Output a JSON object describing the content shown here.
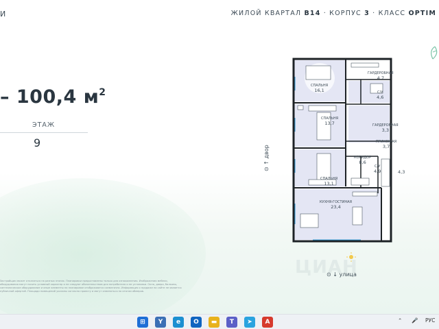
{
  "header": {
    "title_left": "И",
    "title_right_parts": [
      {
        "text": "ЖИЛОЙ КВАРТАЛ ",
        "bold": false
      },
      {
        "text": "B14",
        "bold": true
      },
      {
        "text": " · КОРПУС ",
        "bold": false
      },
      {
        "text": "3",
        "bold": true
      },
      {
        "text": " · КЛАСС ",
        "bold": false
      },
      {
        "text": "OPTIM",
        "bold": true
      }
    ]
  },
  "apartment": {
    "area": "– 100,4 м",
    "area_sup": "2",
    "floor_label": "ЭТАЖ",
    "floor_value": "9"
  },
  "plan": {
    "rooms": [
      {
        "name": "СПАЛЬНЯ",
        "area": "16,1"
      },
      {
        "name": "ГАРДЕРОБНАЯ",
        "area": "4,7"
      },
      {
        "name": "С/У",
        "area": "4,6"
      },
      {
        "name": "СПАЛЬНЯ",
        "area": "13,7"
      },
      {
        "name": "ГАРДЕРОБНАЯ",
        "area": "3,3"
      },
      {
        "name": "ПРИХОЖАЯ",
        "area": "3,7"
      },
      {
        "name": "КОРИДОР",
        "area": "8,6"
      },
      {
        "name": "СПАЛЬНЯ",
        "area": "13,1"
      },
      {
        "name": "С/У",
        "area": "4,9"
      },
      {
        "name": "",
        "area": "4,3"
      },
      {
        "name": "КУХНЯ-ГОСТИНАЯ",
        "area": "23,4"
      }
    ],
    "side_label": "⊙ ↑ двор",
    "bottom_label": "⊙ ↓ улица"
  },
  "watermark": "ЦИАН",
  "footnote": "Застройщик может отказаться на разных этапах. Планировки предоставлены только для ознакомления. Изображения мебели, оборудования могут носить условный характер и не следуют обязательствам для потребителя и не установки. Окна, двери, балконы, сантехническое оборудование и иные элементы на планировке отображаются схематично. Информация о продаже на сайте не является публичной офертой. Площади помещений указаны согласно проекту и могут изменяться по итогам обмеров.",
  "taskbar": {
    "apps": [
      {
        "icon": "windows-start-icon",
        "color": "#1f6fd6"
      },
      {
        "icon": "yandex-browser-icon",
        "color": "#3b6fb5"
      },
      {
        "icon": "edge-browser-icon",
        "color": "#1c8fd1"
      },
      {
        "icon": "outlook-icon",
        "color": "#0f64c0"
      },
      {
        "icon": "file-explorer-icon",
        "color": "#e8b21c"
      },
      {
        "icon": "teams-icon",
        "color": "#5b5fc7"
      },
      {
        "icon": "telegram-icon",
        "color": "#2aa3df"
      },
      {
        "icon": "pdf-reader-icon",
        "color": "#d63a2d"
      }
    ],
    "tray_lang": "РУС"
  },
  "colors": {
    "room_fill": "#e4e6f4",
    "wall": "#1d2226",
    "accent_blue": "#2d9ad6"
  }
}
